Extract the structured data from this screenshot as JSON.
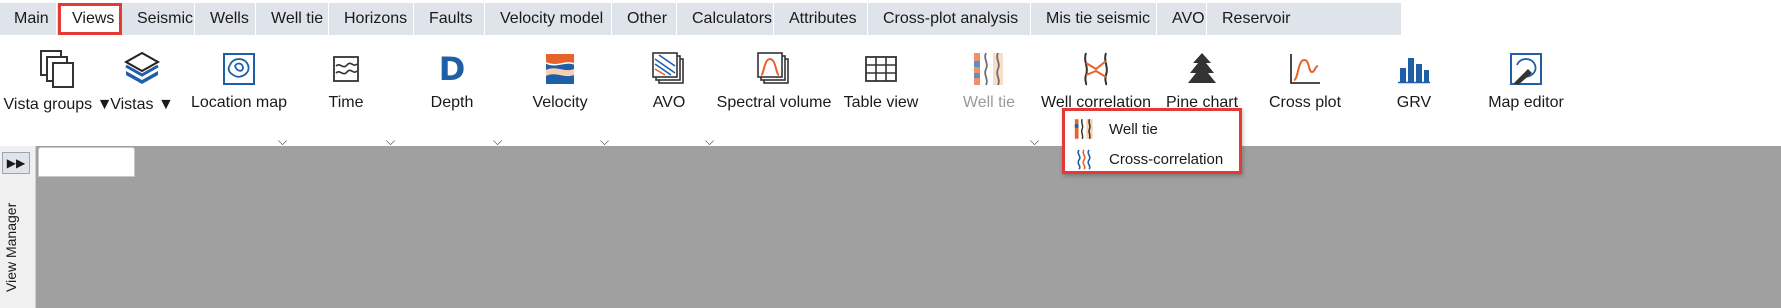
{
  "tabs": [
    {
      "label": "Main"
    },
    {
      "label": "Views",
      "active": true
    },
    {
      "label": "Seismic"
    },
    {
      "label": "Wells"
    },
    {
      "label": "Well tie"
    },
    {
      "label": "Horizons"
    },
    {
      "label": "Faults"
    },
    {
      "label": "Velocity model"
    },
    {
      "label": "Other"
    },
    {
      "label": "Calculators"
    },
    {
      "label": "Attributes"
    },
    {
      "label": "Cross-plot analysis"
    },
    {
      "label": "Mis tie seismic"
    },
    {
      "label": "AVO"
    },
    {
      "label": "Reservoir"
    }
  ],
  "ribbon": {
    "vista_groups": "Vista groups ▼",
    "vistas": "Vistas ▼",
    "location_map": "Location map",
    "time": "Time",
    "depth": "Depth",
    "velocity": "Velocity",
    "avo": "AVO",
    "spectral_volume": "Spectral volume",
    "table_view": "Table view",
    "well_tie": "Well tie",
    "well_correlation": "Well correlation",
    "pine_chart": "Pine chart",
    "cross_plot": "Cross plot",
    "grv": "GRV",
    "map_editor": "Map editor"
  },
  "dropdown": {
    "items": [
      {
        "label": "Well tie"
      },
      {
        "label": "Cross-correlation"
      }
    ]
  },
  "side": {
    "view_manager": "View Manager",
    "expand": "▶▶"
  },
  "colors": {
    "highlight": "#e53935",
    "tabbar": "#dfe3ea",
    "canvas": "#a0a0a0",
    "accent_blue": "#1f5fa8",
    "accent_orange": "#e8632b"
  }
}
